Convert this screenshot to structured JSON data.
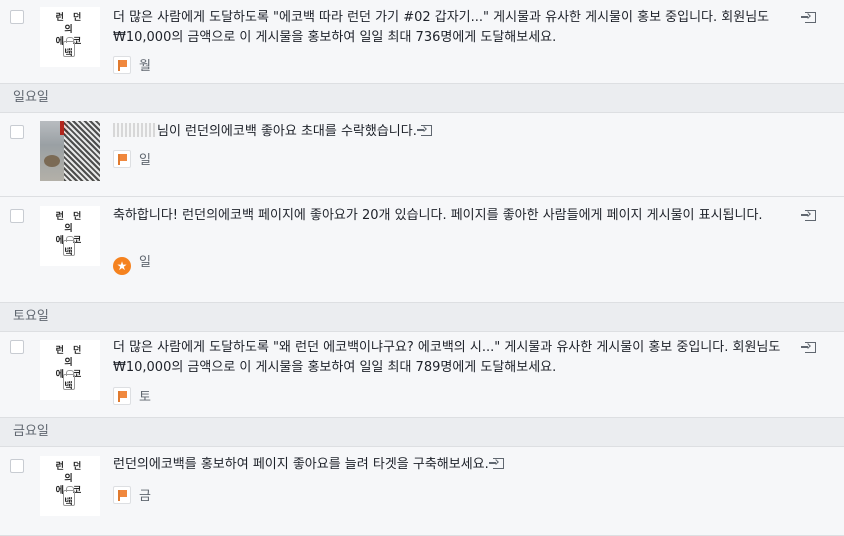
{
  "days": {
    "sunday": "일요일",
    "saturday": "토요일",
    "friday": "금요일"
  },
  "notifications": [
    {
      "text": "더 많은 사람에게 도달하도록 \"에코백 따라 런던 가기 #02 갑자기...\" 게시물과 유사한 게시물이 홍보 중입니다. 회원님도 ₩10,000의 금액으로 이 게시물을 홍보하여 일일 최대 736명에게 도달해보세요.",
      "time": "월",
      "icon": "flag-icon"
    },
    {
      "text": "님이 런던의에코백 좋아요 초대를 수락했습니다.",
      "time": "일",
      "icon": "flag-icon"
    },
    {
      "text": "축하합니다! 런던의에코백 페이지에 좋아요가 20개 있습니다. 페이지를 좋아한 사람들에게 페이지 게시물이 표시됩니다.",
      "time": "일",
      "icon": "star-icon"
    },
    {
      "text": "더 많은 사람에게 도달하도록 \"왜 런던 에코백이냐구요? 에코백의 시...\" 게시물과 유사한 게시물이 홍보 중입니다. 회원님도 ₩10,000의 금액으로 이 게시물을 홍보하여 일일 최대 789명에게 도달해보세요.",
      "time": "토",
      "icon": "flag-icon"
    },
    {
      "text": "런던의에코백를 홍보하여 페이지 좋아요를 늘려 타겟을 구축해보세요.",
      "time": "금",
      "icon": "flag-icon"
    }
  ],
  "page_logo": {
    "line1": "런 던 의",
    "line2": "에 코 백"
  },
  "colors": {
    "row_bg": "#f6f7f9",
    "header_bg": "#ebedf0",
    "accent_orange": "#f5821f"
  }
}
